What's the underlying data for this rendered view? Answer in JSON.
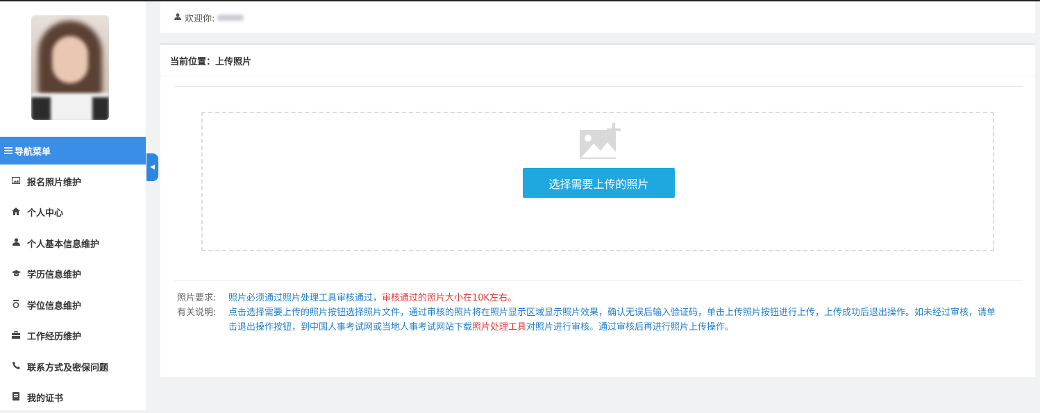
{
  "header": {
    "welcome_label": "欢迎你:"
  },
  "sidebar": {
    "nav_title": "导航菜单",
    "items": [
      {
        "label": "报名照片维护",
        "icon": "image-icon"
      },
      {
        "label": "个人中心",
        "icon": "home-icon"
      },
      {
        "label": "个人基本信息维护",
        "icon": "user-icon"
      },
      {
        "label": "学历信息维护",
        "icon": "graduation-cap-icon"
      },
      {
        "label": "学位信息维护",
        "icon": "medal-icon"
      },
      {
        "label": "工作经历维护",
        "icon": "briefcase-icon"
      },
      {
        "label": "联系方式及密保问题",
        "icon": "phone-icon"
      },
      {
        "label": "我的证书",
        "icon": "book-icon"
      }
    ]
  },
  "main": {
    "breadcrumb": "当前位置：上传照片",
    "upload_button": "选择需要上传的照片",
    "requirements": {
      "label": "照片要求:",
      "text_blue": "照片必须通过照片处理工具审核通过，",
      "text_red": "审核通过的照片大小在10K左右。"
    },
    "instructions": {
      "label": "有关说明:",
      "text_1": "点击选择需要上传的照片按钮选择照片文件，通过审核的照片将在照片显示区域显示照片效果，确认无误后输入验证码，单击上传照片按钮进行上传，上传成功后退出操作。如未经过审核，请单击退出操作按钮，到中国人事考试网或当地人事考试网站下载",
      "link": "照片处理工具",
      "text_2": "对照片进行审核。通过审核后再进行照片上传操作。"
    }
  },
  "colors": {
    "accent": "#3a8ee6",
    "button": "#1fa7e0",
    "note_blue": "#1f7fcf",
    "note_red": "#e53935"
  }
}
